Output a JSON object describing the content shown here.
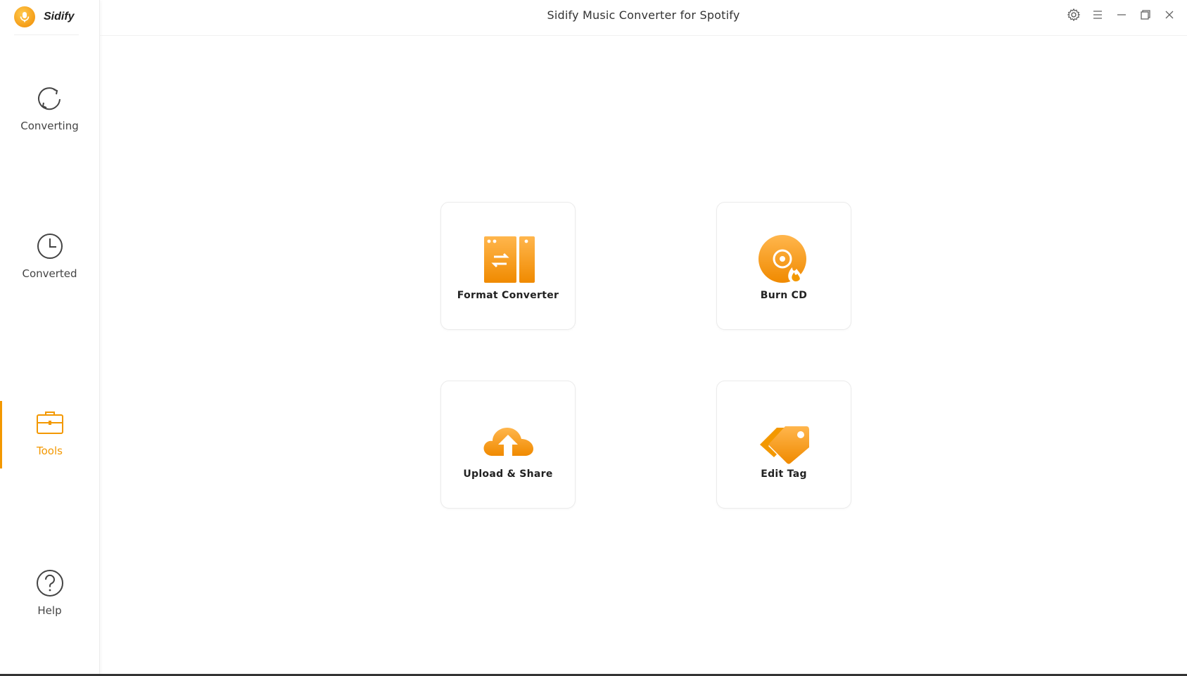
{
  "brand": {
    "name": "Sidify"
  },
  "window": {
    "title": "Sidify Music Converter for Spotify"
  },
  "sidebar": {
    "items": [
      {
        "label": "Converting",
        "icon": "refresh-icon"
      },
      {
        "label": "Converted",
        "icon": "clock-icon"
      },
      {
        "label": "Tools",
        "icon": "toolbox-icon",
        "active": true
      },
      {
        "label": "Help",
        "icon": "help-icon"
      }
    ]
  },
  "tools": [
    {
      "label": "Format Converter",
      "icon": "format-converter-icon"
    },
    {
      "label": "Burn CD",
      "icon": "burn-cd-icon"
    },
    {
      "label": "Upload & Share",
      "icon": "upload-cloud-icon"
    },
    {
      "label": "Edit Tag",
      "icon": "tag-icon"
    }
  ],
  "colors": {
    "accent": "#f39800",
    "accent_light": "#ffb64d"
  }
}
